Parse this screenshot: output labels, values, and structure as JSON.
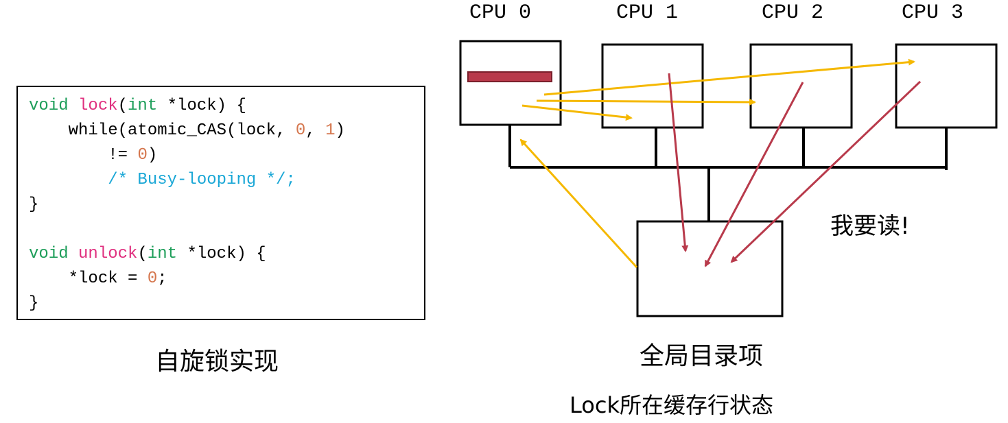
{
  "code": {
    "lines": [
      [
        {
          "t": "void",
          "c": "kw"
        },
        {
          "t": " "
        },
        {
          "t": "lock",
          "c": "fn"
        },
        {
          "t": "("
        },
        {
          "t": "int",
          "c": "kw"
        },
        {
          "t": " *lock) {"
        }
      ],
      [
        {
          "t": "    while(atomic_CAS(lock, "
        },
        {
          "t": "0",
          "c": "num"
        },
        {
          "t": ", "
        },
        {
          "t": "1",
          "c": "num"
        },
        {
          "t": ")"
        }
      ],
      [
        {
          "t": "        != "
        },
        {
          "t": "0",
          "c": "num"
        },
        {
          "t": ")"
        }
      ],
      [
        {
          "t": "        "
        },
        {
          "t": "/* Busy-looping */;",
          "c": "cm"
        }
      ],
      [
        {
          "t": "}"
        }
      ],
      [
        {
          "t": ""
        }
      ],
      [
        {
          "t": "void",
          "c": "kw"
        },
        {
          "t": " "
        },
        {
          "t": "unlock",
          "c": "fn"
        },
        {
          "t": "("
        },
        {
          "t": "int",
          "c": "kw"
        },
        {
          "t": " *lock) {"
        }
      ],
      [
        {
          "t": "    *lock = "
        },
        {
          "t": "0",
          "c": "num"
        },
        {
          "t": ";"
        }
      ],
      [
        {
          "t": "}"
        }
      ]
    ]
  },
  "caption_left": "自旋锁实现",
  "cpus": [
    "CPU 0",
    "CPU 1",
    "CPU 2",
    "CPU 3"
  ],
  "directory_label": "全局目录项",
  "state_label": "Lock所在缓存行状态",
  "read_label": "我要读!",
  "colors": {
    "write_arrow": "#f5b800",
    "read_arrow": "#b83a4b",
    "cache_line": "#b83a4b"
  }
}
